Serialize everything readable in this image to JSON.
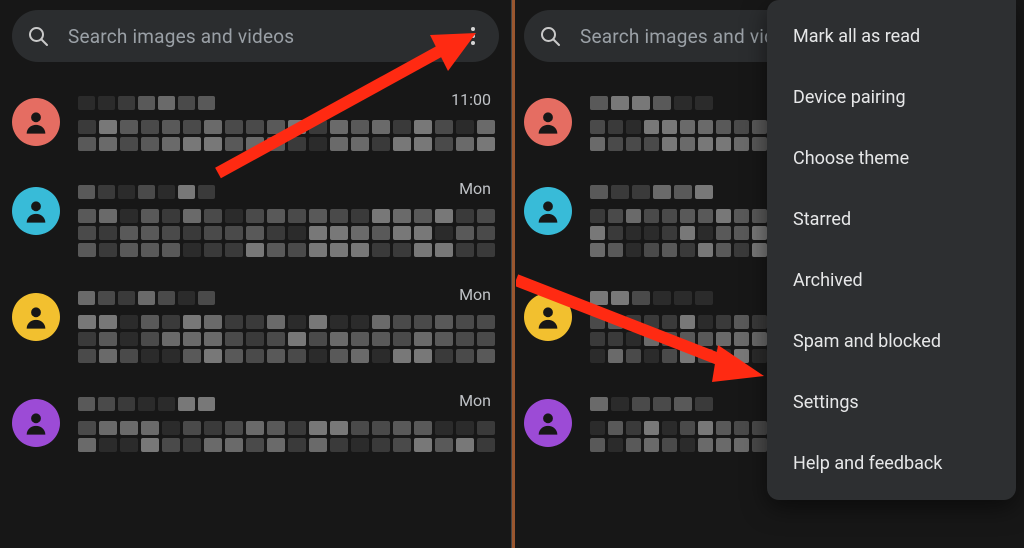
{
  "search": {
    "placeholder": "Search images and videos"
  },
  "conversations": [
    {
      "time": "11:00",
      "avatar_color": "#e56d62"
    },
    {
      "time": "Mon",
      "avatar_color": "#38bbd8"
    },
    {
      "time": "Mon",
      "avatar_color": "#f2c02f"
    },
    {
      "time": "Mon",
      "avatar_color": "#9c4bd6"
    }
  ],
  "menu": {
    "items": [
      "Mark all as read",
      "Device pairing",
      "Choose theme",
      "Starred",
      "Archived",
      "Spam and blocked",
      "Settings",
      "Help and feedback"
    ]
  }
}
